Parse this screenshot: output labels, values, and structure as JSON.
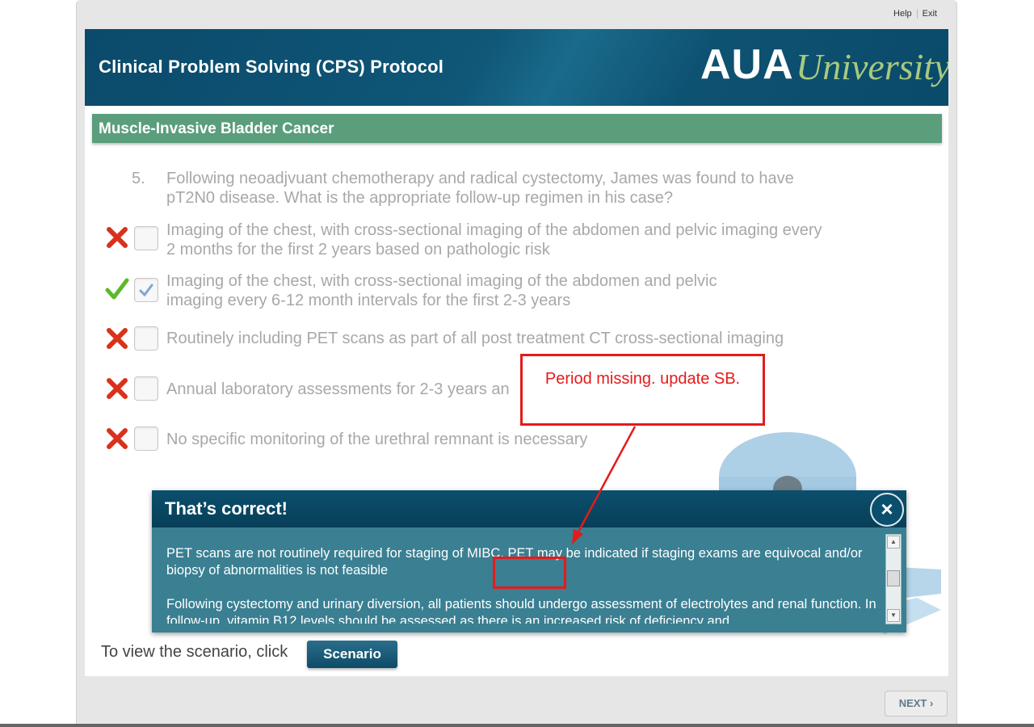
{
  "top_links": {
    "help": "Help",
    "exit": "Exit"
  },
  "header": {
    "title": "Clinical Problem Solving (CPS) Protocol",
    "logo_aua": "AUA",
    "logo_university": "University"
  },
  "section": {
    "title": "Muscle-Invasive Bladder Cancer"
  },
  "question": {
    "number": "5.",
    "text": "Following neoadjvuant chemotherapy and radical cystectomy, James was found to have pT2N0 disease. What is the appropriate follow-up regimen in his case?"
  },
  "options": [
    {
      "text": "Imaging of the chest, with cross-sectional imaging of the abdomen and pelvic imaging every 2 months for the first 2 years based on pathologic risk",
      "mark": "incorrect",
      "checked": false
    },
    {
      "text": "Imaging of the chest, with cross-sectional imaging of the abdomen and pelvic imaging every 6-12 month intervals for the first 2-3 years",
      "mark": "correct",
      "checked": true
    },
    {
      "text": "Routinely including PET scans as part of all post treatment CT cross-sectional imaging",
      "mark": "incorrect",
      "checked": false
    },
    {
      "text": "Annual laboratory assessments for 2-3 years an",
      "mark": "incorrect",
      "checked": false
    },
    {
      "text": "No specific monitoring of the urethral remnant is necessary",
      "mark": "incorrect",
      "checked": false
    }
  ],
  "feedback": {
    "title": "That’s correct!",
    "close_icon": "×",
    "paragraphs": [
      "PET scans are not routinely required for staging of MIBC. PET may be indicated if staging exams are equivocal and/or biopsy of abnormalities is not feasible",
      "Following cystectomy and urinary diversion, all patients should undergo assessment of electrolytes and renal function. In follow-up, vitamin B12 levels should be assessed as there is an increased risk of deficiency and"
    ]
  },
  "scenario": {
    "prompt": "To view the scenario, click",
    "button": "Scenario"
  },
  "next": {
    "label": "NEXT ›"
  },
  "annotation": {
    "text": "Period missing. update SB."
  },
  "colors": {
    "header": "#0b4a6b",
    "section": "#5a9e7c",
    "annotation": "#e41b1b",
    "correct": "#5cb82a",
    "incorrect": "#d9321c"
  }
}
